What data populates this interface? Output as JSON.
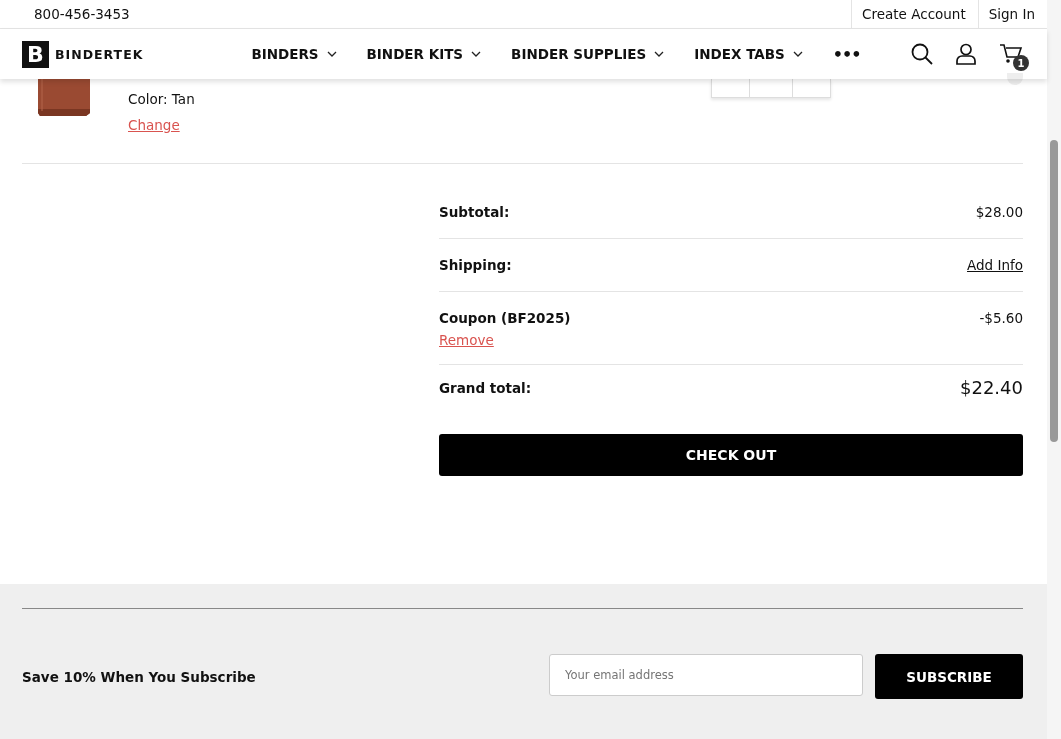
{
  "top_bar": {
    "phone": "800-456-3453",
    "links": [
      "Create Account",
      "Sign In"
    ]
  },
  "nav": {
    "logo_letter": "B",
    "logo_text": "BINDERTEK",
    "items": [
      {
        "label": "BINDERS"
      },
      {
        "label": "BINDER KITS"
      },
      {
        "label": "BINDER SUPPLIES"
      },
      {
        "label": "INDEX TABS"
      }
    ],
    "more": "•••",
    "cart_count": "1"
  },
  "cart_item": {
    "color_label": "Color:",
    "color_value": "Tan",
    "change_link": "Change"
  },
  "summary": {
    "rows": [
      {
        "kind": "amount",
        "label": "Subtotal:",
        "value": "$28.00"
      },
      {
        "kind": "link",
        "label": "Shipping:",
        "value": "Add Info"
      },
      {
        "kind": "coupon",
        "label": "Coupon (BF2025)",
        "value": "-$5.60",
        "action": "Remove"
      },
      {
        "kind": "total",
        "label": "Grand total:",
        "value": "$22.40"
      }
    ],
    "checkout_button": "CHECK OUT"
  },
  "footer": {
    "subscribe_text": "Save 10% When You Subscribe",
    "email": {
      "placeholder": "Your email address"
    },
    "subscribe_button": "SUBSCRIBE"
  }
}
